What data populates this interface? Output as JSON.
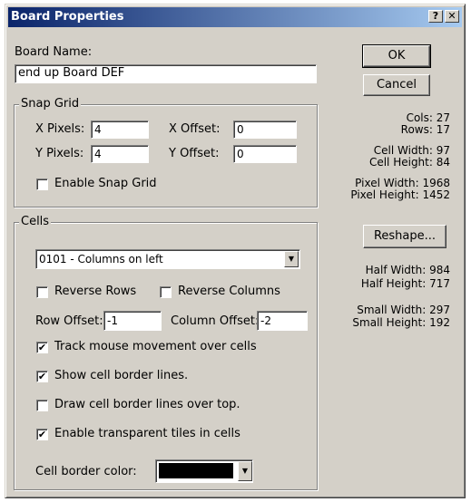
{
  "window": {
    "title": "Board Properties",
    "help_label": "?",
    "close_label": "✕"
  },
  "board_name": {
    "label": "Board Name:",
    "value": "end up Board DEF"
  },
  "buttons": {
    "ok": "OK",
    "cancel": "Cancel",
    "reshape": "Reshape..."
  },
  "snap_grid": {
    "legend": "Snap Grid",
    "x_pixels_label": "X Pixels:",
    "x_pixels_value": "4",
    "y_pixels_label": "Y Pixels:",
    "y_pixels_value": "4",
    "x_offset_label": "X Offset:",
    "x_offset_value": "0",
    "y_offset_label": "Y Offset:",
    "y_offset_value": "0",
    "enable_label": "Enable Snap Grid",
    "enable_checked": false
  },
  "info": {
    "cols": "Cols: 27",
    "rows": "Rows: 17",
    "cell_width": "Cell Width: 97",
    "cell_height": "Cell Height: 84",
    "pixel_width": "Pixel Width: 1968",
    "pixel_height": "Pixel Height: 1452",
    "half_width": "Half Width: 984",
    "half_height": "Half Height: 717",
    "small_width": "Small Width: 297",
    "small_height": "Small Height: 192"
  },
  "cells": {
    "legend": "Cells",
    "layout_selected": "0101 - Columns on left",
    "reverse_rows_label": "Reverse Rows",
    "reverse_columns_label": "Reverse Columns",
    "row_offset_label": "Row Offset:",
    "row_offset_value": "-1",
    "column_offset_label": "Column Offset:",
    "column_offset_value": "-2",
    "track_mouse_label": "Track mouse movement over cells",
    "show_border_label": "Show cell border lines.",
    "draw_border_top_label": "Draw cell border lines over top.",
    "transparent_tiles_label": "Enable transparent tiles in cells",
    "border_color_label": "Cell border color:",
    "border_color_value": "#000000",
    "check_mark": "✔"
  }
}
